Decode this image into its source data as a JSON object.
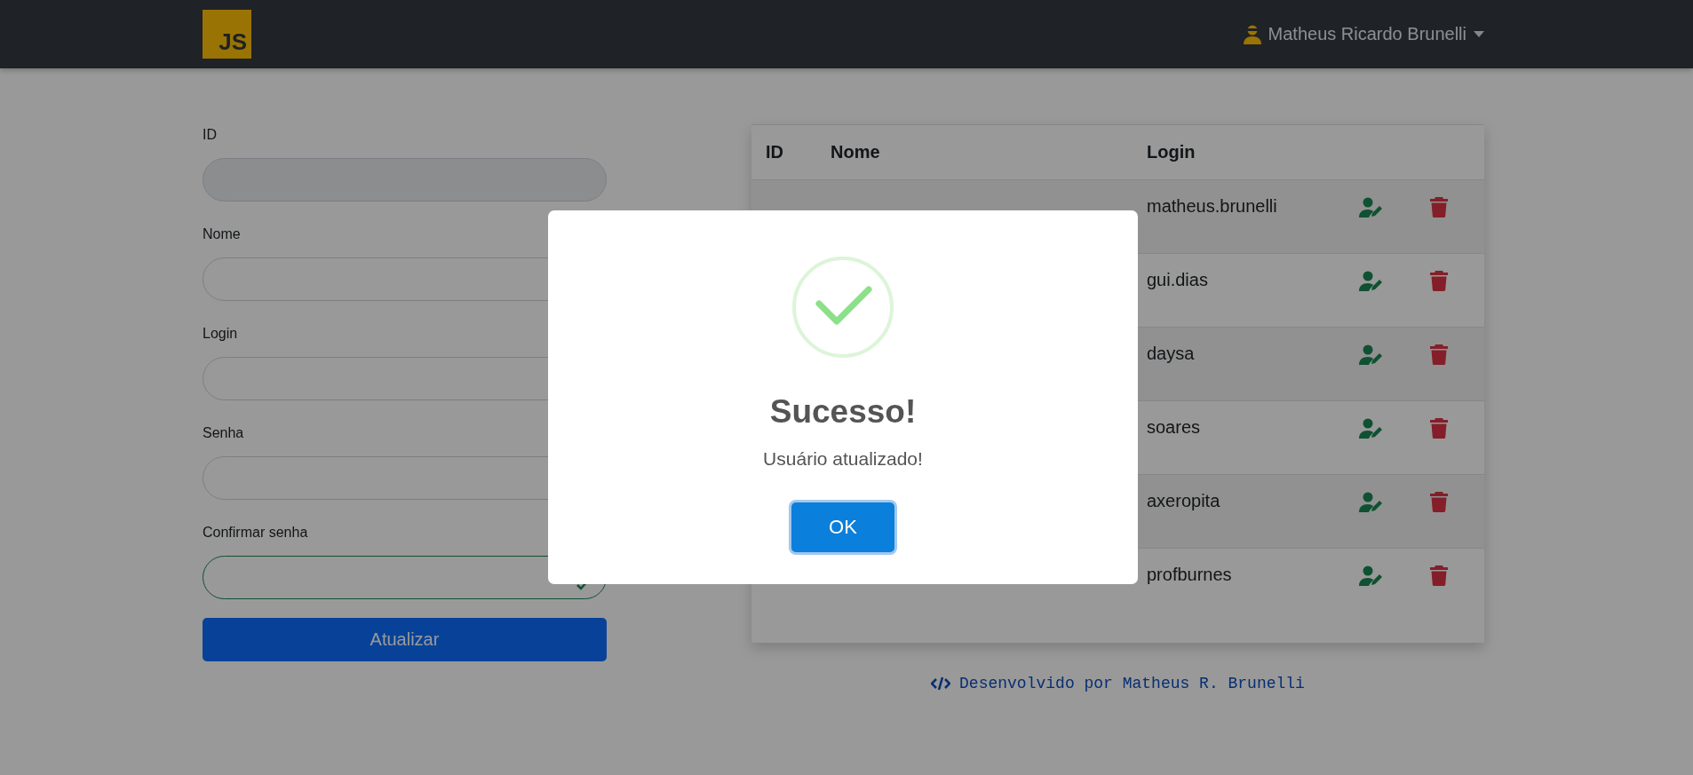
{
  "navbar": {
    "logo": "JS",
    "user_name": "Matheus Ricardo Brunelli"
  },
  "form": {
    "fields": [
      {
        "label": "ID",
        "disabled": true,
        "valid": false
      },
      {
        "label": "Nome",
        "disabled": false,
        "valid": false
      },
      {
        "label": "Login",
        "disabled": false,
        "valid": false
      },
      {
        "label": "Senha",
        "disabled": false,
        "valid": false
      },
      {
        "label": "Confirmar senha",
        "disabled": false,
        "valid": true
      }
    ],
    "submit": "Atualizar"
  },
  "table": {
    "columns": [
      "ID",
      "Nome",
      "Login"
    ],
    "rows": [
      {
        "login": "matheus.brunelli"
      },
      {
        "login": "gui.dias"
      },
      {
        "login": "daysa"
      },
      {
        "login": "soares"
      },
      {
        "login": "axeropita"
      },
      {
        "login": "profburnes"
      }
    ]
  },
  "footer": "Desenvolvido por Matheus R. Brunelli",
  "dialog": {
    "title": "Sucesso!",
    "message": "Usuário atualizado!",
    "button": "OK"
  }
}
